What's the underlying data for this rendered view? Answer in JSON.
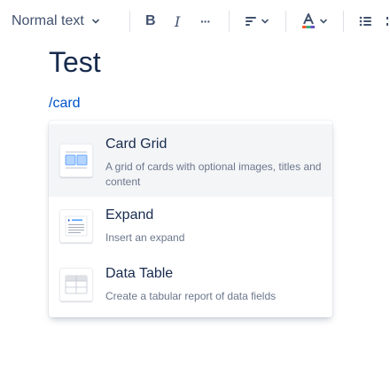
{
  "toolbar": {
    "text_style": "Normal text",
    "bold_label": "B",
    "italic_label": "I",
    "more_label": "···"
  },
  "editor": {
    "title": "Test",
    "slash_command": "/card"
  },
  "menu": {
    "items": [
      {
        "title": "Card Grid",
        "description": "A grid of cards with optional images, titles and content",
        "icon": "card-grid-icon",
        "active": true
      },
      {
        "title": "Expand",
        "description": "Insert an expand",
        "icon": "expand-icon",
        "active": false
      },
      {
        "title": "Data Table",
        "description": "Create a tabular report of data fields",
        "icon": "data-table-icon",
        "active": false
      }
    ]
  },
  "colors": {
    "link": "#0052CC",
    "text": "#172B4D",
    "subtle": "#6B778C",
    "highlight": "#F4F5F7",
    "icon_blue": "#B3D4FF"
  }
}
